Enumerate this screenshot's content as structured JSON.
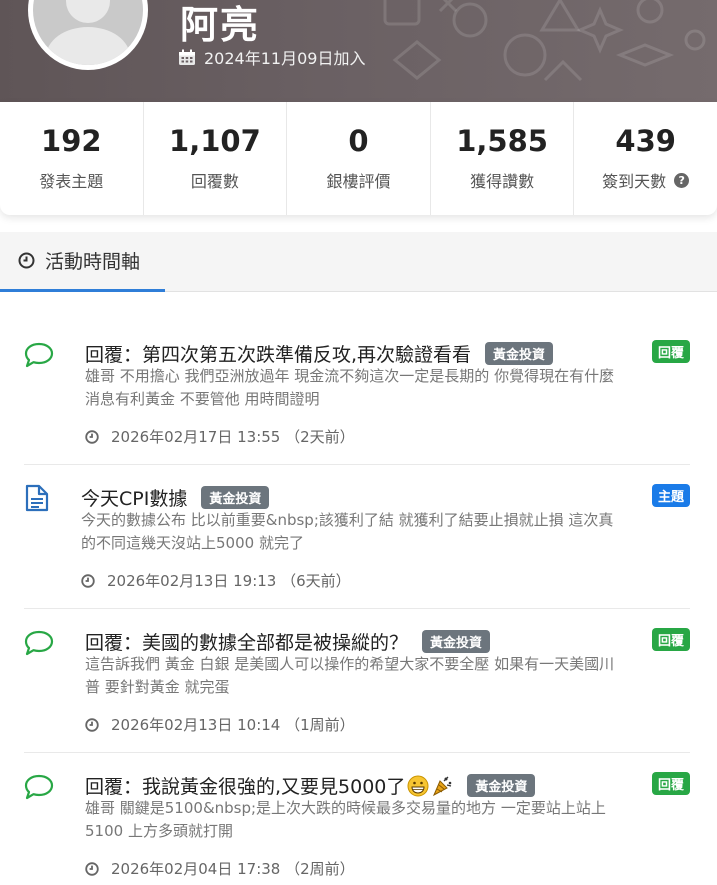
{
  "profile": {
    "username": "阿亮",
    "joined": "2024年11月09日加入"
  },
  "stats": [
    {
      "value": "192",
      "label": "發表主題"
    },
    {
      "value": "1,107",
      "label": "回覆數"
    },
    {
      "value": "0",
      "label": "銀樓評價"
    },
    {
      "value": "1,585",
      "label": "獲得讚數"
    },
    {
      "value": "439",
      "label": "簽到天數",
      "help": "?"
    }
  ],
  "tabs": [
    {
      "label": "活動時間軸",
      "active": true
    }
  ],
  "feed": [
    {
      "type": "reply",
      "icon": "comment-icon",
      "title": "回覆：第四次第五次跌準備反攻,再次驗證看看",
      "category": "黃金投資",
      "badge": "回覆",
      "badge_color": "#28a745",
      "excerpt": "雄哥 不用擔心 我們亞洲放過年 現金流不夠這次一定是長期的 你覺得現在有什麼消息有利黃金 不要管他 用時間證明",
      "time": "2026年02月17日 13:55 （2天前）"
    },
    {
      "type": "topic",
      "icon": "document-icon",
      "title": "今天CPI數據",
      "category": "黃金投資",
      "badge": "主題",
      "badge_color": "#1a7be8",
      "excerpt": "今天的數據公布 比以前重要&nbsp;該獲利了結 就獲利了結要止損就止損 這次真的不同這幾天沒站上5000 就完了",
      "time": "2026年02月13日 19:13 （6天前）"
    },
    {
      "type": "reply",
      "icon": "comment-icon",
      "title": "回覆：美國的數據全部都是被操縱的？",
      "category": "黃金投資",
      "badge": "回覆",
      "badge_color": "#28a745",
      "excerpt": "這告訴我們 黃金 白銀 是美國人可以操作的希望大家不要全壓 如果有一天美國川普 要針對黃金 就完蛋",
      "time": "2026年02月13日 10:14 （1周前）"
    },
    {
      "type": "reply",
      "icon": "comment-icon",
      "title": "回覆：我說黃金很強的,又要見5000了",
      "category": "黃金投資",
      "badge": "回覆",
      "badge_color": "#28a745",
      "excerpt": "雄哥 關鍵是5100&nbsp;是上次大跌的時候最多交易量的地方 一定要站上站上 5100 上方多頭就打開",
      "time": "2026年02月04日 17:38 （2周前）"
    }
  ]
}
